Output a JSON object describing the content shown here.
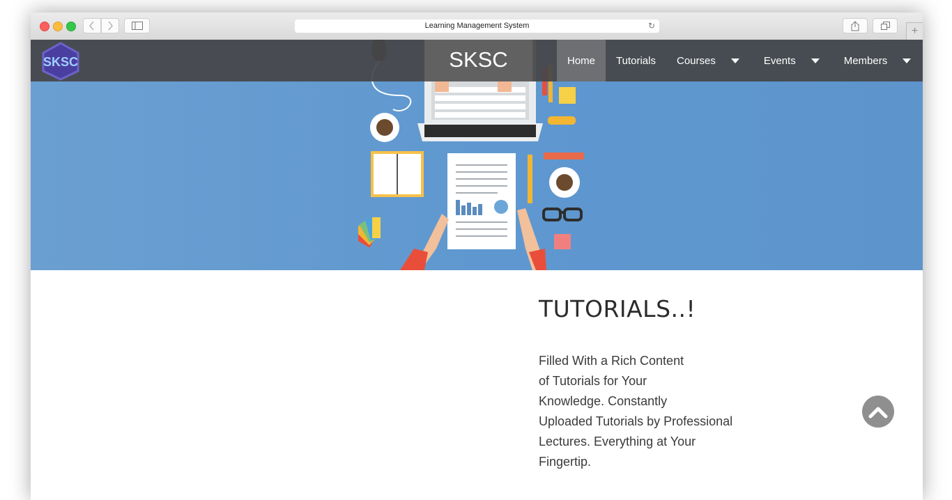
{
  "browser": {
    "address_text": "Learning Management System",
    "traffic_lights": [
      "#fc605c",
      "#fdbc40",
      "#34c84a"
    ]
  },
  "site": {
    "logo_text": "SKSC",
    "brand": "SKSC",
    "nav": [
      {
        "label": "Home",
        "active": true
      },
      {
        "label": "Tutorials",
        "active": false
      },
      {
        "label": "Courses",
        "dropdown": true
      },
      {
        "label": "Events",
        "dropdown": true
      },
      {
        "label": "Members",
        "dropdown": true
      }
    ]
  },
  "hero": {
    "background": "#5f98d0",
    "illustration": "desk-workspace-illustration"
  },
  "content": {
    "title": "TUTORIALS..!",
    "description_lines": [
      "Filled With a Rich Content",
      "of Tutorials for Your",
      "Knowledge. Constantly",
      "Uploaded Tutorials by Professional",
      "Lectures. Everything at Your",
      "Fingertip."
    ]
  },
  "icons": {
    "scroll_top": "chevron-up-icon"
  }
}
